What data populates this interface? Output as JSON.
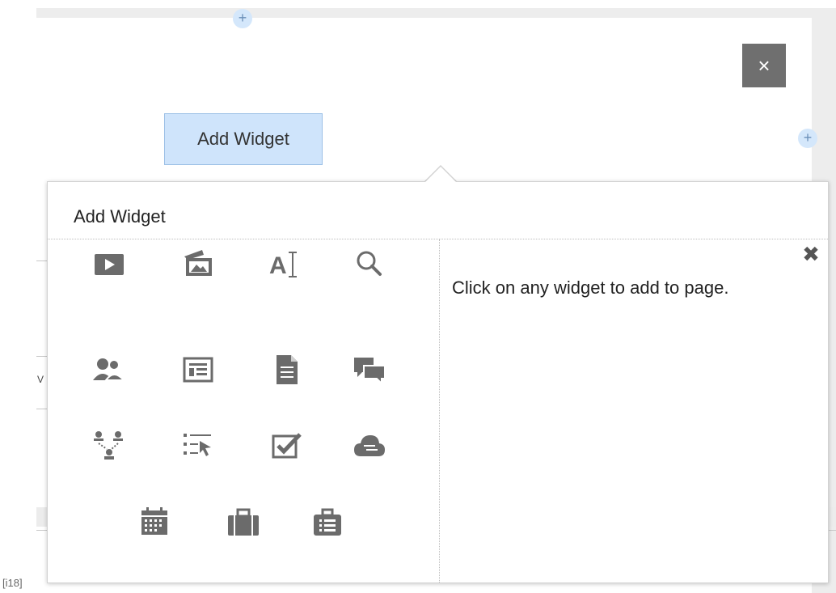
{
  "canvas": {
    "add_widget_button_label": "Add Widget",
    "close_button_glyph": "×",
    "plus_glyph": "+",
    "side_fragment": "V"
  },
  "popover": {
    "title": "Add Widget",
    "close_glyph": "✖",
    "hint": "Click on any widget to add to page.",
    "widgets": [
      {
        "icon": "video-icon"
      },
      {
        "icon": "image-gallery-icon"
      },
      {
        "icon": "text-icon"
      },
      {
        "icon": "search-icon"
      },
      {
        "icon": "people-icon"
      },
      {
        "icon": "news-icon"
      },
      {
        "icon": "document-icon"
      },
      {
        "icon": "discussion-icon"
      },
      {
        "icon": "org-chart-icon"
      },
      {
        "icon": "list-select-icon"
      },
      {
        "icon": "checkbox-icon"
      },
      {
        "icon": "cloud-icon"
      },
      {
        "icon": "calendar-icon"
      },
      {
        "icon": "briefcase-icon"
      },
      {
        "icon": "clipboard-list-icon"
      }
    ]
  },
  "footer": {
    "label": "[i18]"
  },
  "colors": {
    "accent": "#cfe4fb",
    "icon_gray": "#6b6b6b",
    "close_box": "#6f6f6f"
  }
}
